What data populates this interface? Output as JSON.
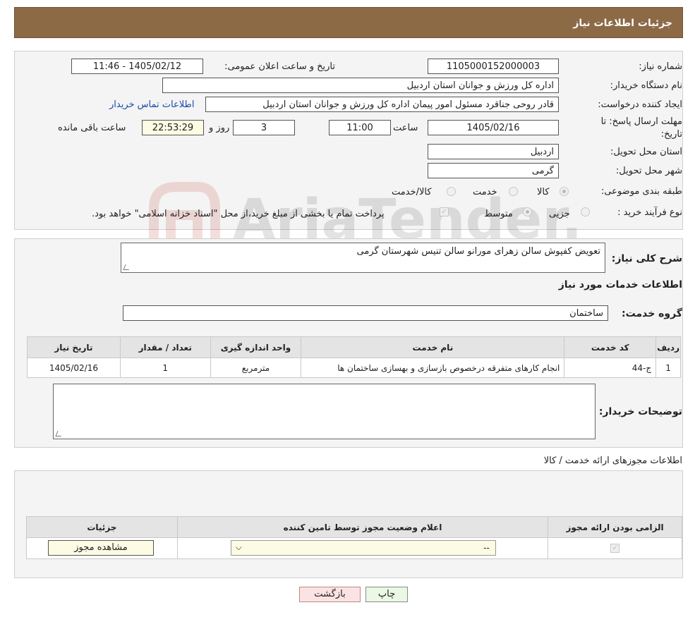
{
  "header": {
    "title": "جزئیات اطلاعات نیاز"
  },
  "info": {
    "need_number_label": "شماره نیاز:",
    "need_number": "1105000152000003",
    "announce_label": "تاریخ و ساعت اعلان عمومی:",
    "announce_value": "1405/02/12 - 11:46",
    "buyer_org_label": "نام دستگاه خریدار:",
    "buyer_org": "اداره کل ورزش و جوانان استان اردبیل",
    "creator_label": "ایجاد کننده درخواست:",
    "creator": "قادر روحی جناقرد مسئول امور پیمان اداره کل ورزش و جوانان استان اردبیل",
    "contact_link": "اطلاعات تماس خریدار",
    "deadline_label_1": "مهلت ارسال پاسخ: تا",
    "deadline_label_2": "تاریخ:",
    "deadline_date": "1405/02/16",
    "hour_label": "ساعت",
    "deadline_time": "11:00",
    "days_value": "3",
    "days_label": "روز و",
    "remaining_time": "22:53:29",
    "remaining_label": "ساعت باقی مانده",
    "province_label": "استان محل تحویل:",
    "province": "اردبیل",
    "city_label": "شهر محل تحویل:",
    "city": "گرمی",
    "category_label": "طبقه بندی موضوعی:",
    "category_options": [
      "کالا",
      "خدمت",
      "کالا/خدمت"
    ],
    "process_label": "نوع فرآیند خرید :",
    "process_options": [
      "جزیی",
      "متوسط"
    ],
    "payment_note": "پرداخت تمام یا بخشی از مبلغ خرید،از محل \"اسناد خزانه اسلامی\" خواهد بود."
  },
  "details": {
    "summary_label": "شرح کلی نیاز:",
    "summary": "تعویض کفپوش سالن زهرای مورانو سالن تنیس شهرستان گرمی",
    "services_title": "اطلاعات خدمات مورد نیاز",
    "service_group_label": "گروه خدمت:",
    "service_group": "ساختمان",
    "table_headers": [
      "ردیف",
      "کد خدمت",
      "نام خدمت",
      "واحد اندازه گیری",
      "تعداد / مقدار",
      "تاریخ نیاز"
    ],
    "table_rows": [
      [
        "1",
        "ج-44",
        "انجام کارهای متفرقه درخصوص بازسازی و بهسازی ساختمان ها",
        "مترمربع",
        "1",
        "1405/02/16"
      ]
    ],
    "buyer_notes_label": "توضیحات خریدار:",
    "buyer_notes": ""
  },
  "permits": {
    "title": "اطلاعات مجوزهای ارائه خدمت / کالا",
    "headers": [
      "الزامی بودن ارائه مجوز",
      "اعلام وضعیت مجوز توسط تامین کننده",
      "جزئیات"
    ],
    "select_value": "--",
    "view_button": "مشاهده مجوز"
  },
  "actions": {
    "print": "چاپ",
    "back": "بازگشت"
  },
  "watermark_text": "AriaTender.neT"
}
